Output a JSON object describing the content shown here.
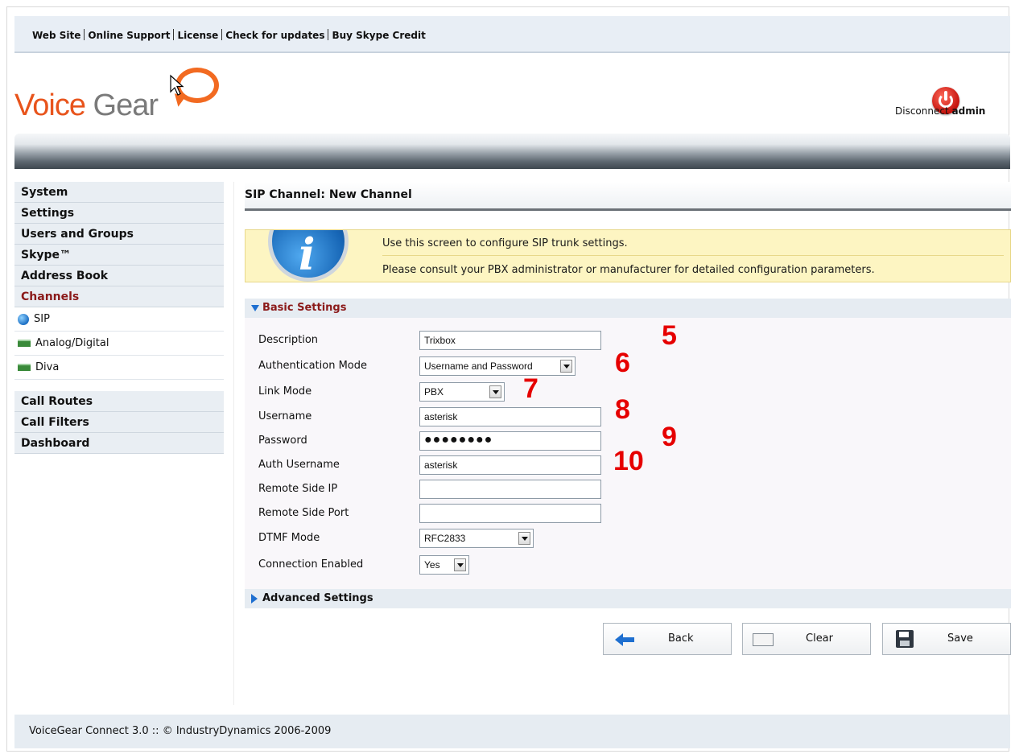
{
  "top_links": [
    "Web Site",
    "Online Support",
    "License",
    "Check for updates",
    "Buy Skype Credit"
  ],
  "logo": {
    "word1": "Voice",
    "word2": " Gear"
  },
  "user": {
    "disconnect_label": "Disconnect",
    "username": "admin"
  },
  "sidebar": {
    "groups": [
      "System",
      "Settings",
      "Users and Groups",
      "Skype™",
      "Address Book",
      "Channels"
    ],
    "channel_items": [
      "SIP",
      "Analog/Digital",
      "Diva"
    ],
    "groups2": [
      "Call Routes",
      "Call Filters",
      "Dashboard"
    ]
  },
  "page": {
    "title": "SIP Channel: New Channel"
  },
  "info": {
    "line1": "Use this screen to configure SIP trunk settings.",
    "line2": "Please consult your PBX administrator or manufacturer for detailed configuration parameters."
  },
  "sections": {
    "basic": "Basic Settings",
    "advanced": "Advanced Settings"
  },
  "form": {
    "description": {
      "label": "Description",
      "value": "Trixbox"
    },
    "auth_mode": {
      "label": "Authentication Mode",
      "value": "Username and Password"
    },
    "link_mode": {
      "label": "Link Mode",
      "value": "PBX"
    },
    "username": {
      "label": "Username",
      "value": "asterisk"
    },
    "password": {
      "label": "Password",
      "value": "●●●●●●●●"
    },
    "auth_username": {
      "label": "Auth Username",
      "value": "asterisk"
    },
    "remote_ip": {
      "label": "Remote Side IP",
      "value": ""
    },
    "remote_port": {
      "label": "Remote Side Port",
      "value": ""
    },
    "dtmf_mode": {
      "label": "DTMF Mode",
      "value": "RFC2833"
    },
    "connection_enabled": {
      "label": "Connection Enabled",
      "value": "Yes"
    }
  },
  "annotations": [
    "5",
    "6",
    "7",
    "8",
    "9",
    "10"
  ],
  "buttons": {
    "back": "Back",
    "clear": "Clear",
    "save": "Save"
  },
  "footer": {
    "text": "VoiceGear Connect 3.0 :: © IndustryDynamics 2006-2009"
  },
  "colors": {
    "accent": "#1e6fd0",
    "active_menu": "#8b1a1a",
    "annotation": "#e60000",
    "logo_orange": "#f26a21"
  }
}
